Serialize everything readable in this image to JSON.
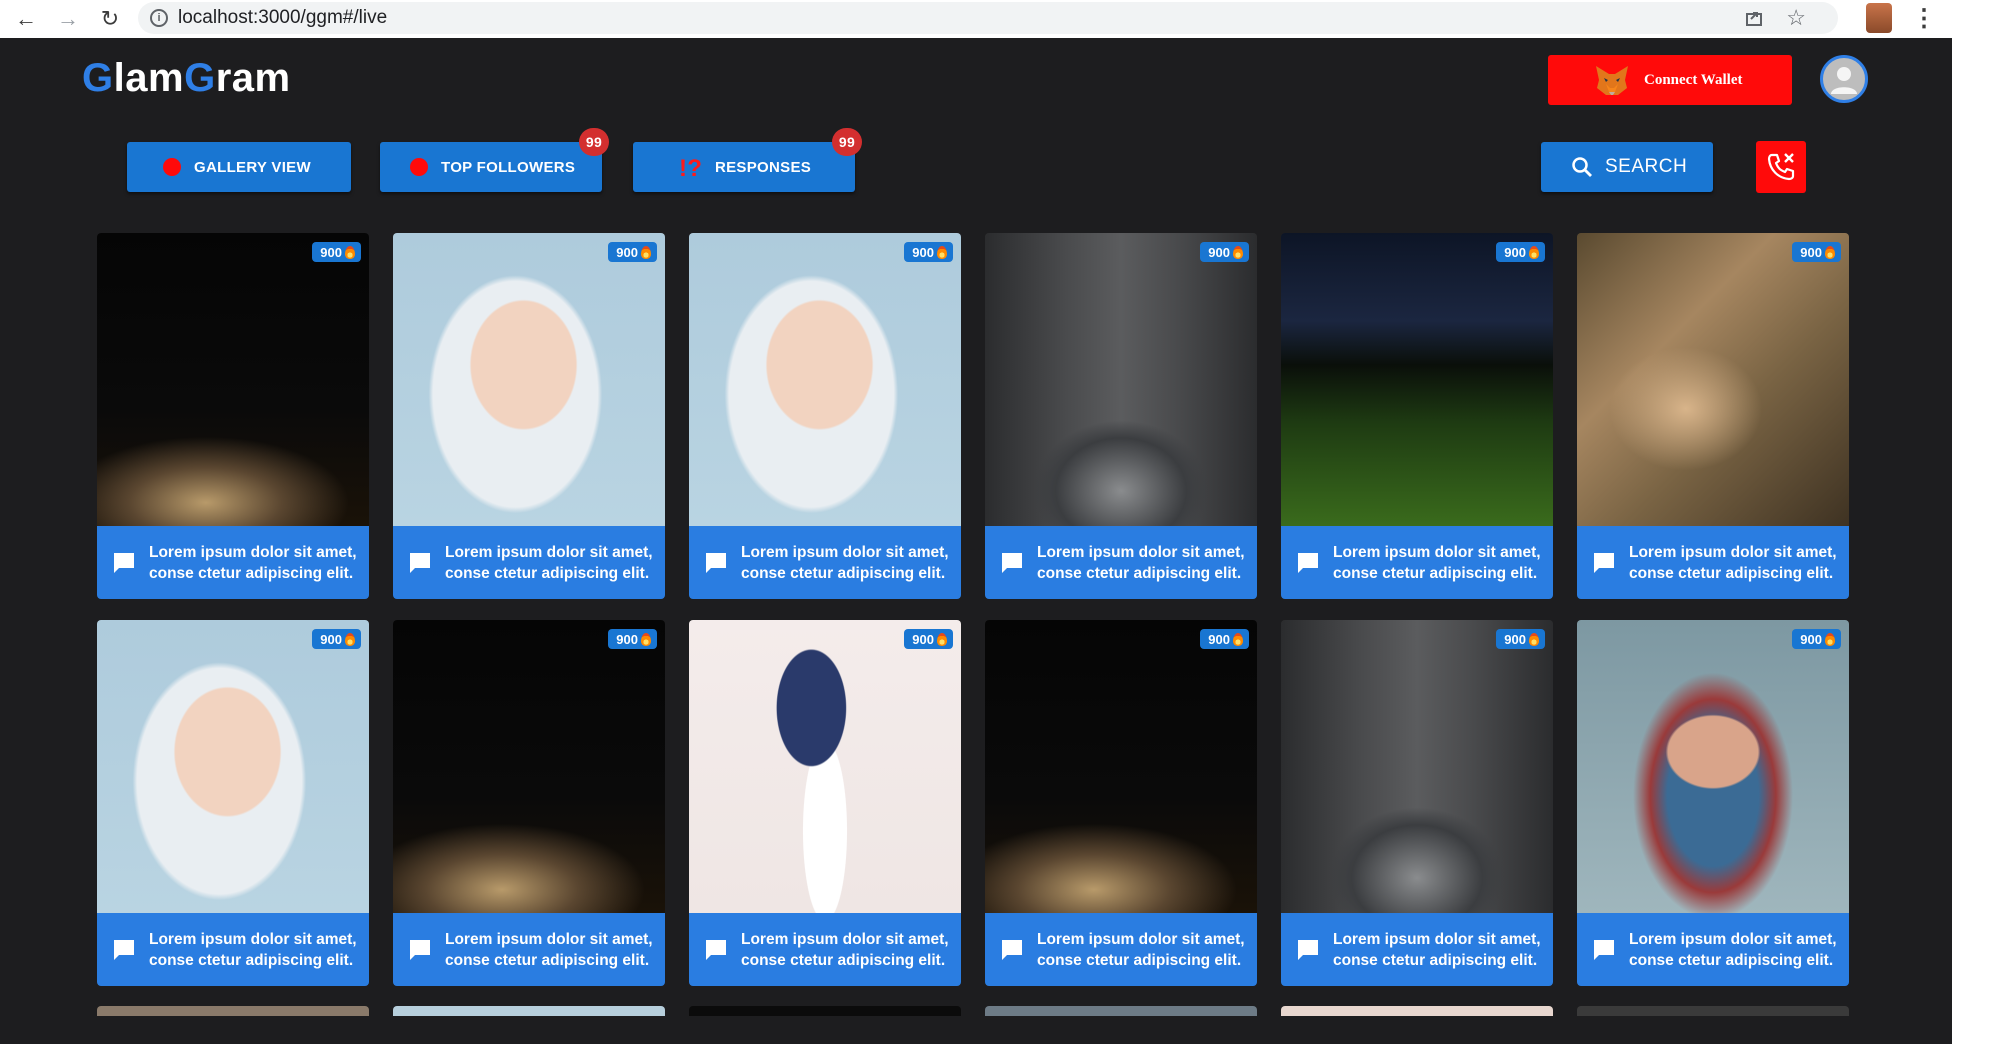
{
  "browser": {
    "url": "localhost:3000/ggm#/live"
  },
  "app": {
    "logo": {
      "g1": "G",
      "part1": "lam",
      "g2": "G",
      "part2": "ram"
    },
    "wallet_button": "Connect Wallet",
    "tabs": [
      {
        "label": "GALLERY VIEW",
        "badge": ""
      },
      {
        "label": "TOP FOLLOWERS",
        "badge": "99"
      },
      {
        "label": "RESPONSES",
        "badge": "99"
      }
    ],
    "search_button": "SEARCH",
    "colors": {
      "brand_blue": "#2f7fe6",
      "accent_red": "#ff0a0a",
      "caption_blue": "#2a7de1",
      "background": "#1d1d1f"
    }
  },
  "cards": [
    {
      "image": "bike-silhouette",
      "count": "900",
      "line1": "Lorem ipsum dolor sit amet,",
      "line2": "conse ctetur adipiscing elit."
    },
    {
      "image": "blonde-woman",
      "count": "900",
      "line1": "Lorem ipsum dolor sit amet,",
      "line2": "conse ctetur adipiscing elit."
    },
    {
      "image": "blonde-woman",
      "count": "900",
      "line1": "Lorem ipsum dolor sit amet,",
      "line2": "conse ctetur adipiscing elit."
    },
    {
      "image": "corridor-figure",
      "count": "900",
      "line1": "Lorem ipsum dolor sit amet,",
      "line2": "conse ctetur adipiscing elit."
    },
    {
      "image": "night-golf",
      "count": "900",
      "line1": "Lorem ipsum dolor sit amet,",
      "line2": "conse ctetur adipiscing elit."
    },
    {
      "image": "rock-lizard",
      "count": "900",
      "line1": "Lorem ipsum dolor sit amet,",
      "line2": "conse ctetur adipiscing elit."
    },
    {
      "image": "blonde-woman",
      "count": "900",
      "line1": "Lorem ipsum dolor sit amet,",
      "line2": "conse ctetur adipiscing elit."
    },
    {
      "image": "bike-silhouette",
      "count": "900",
      "line1": "Lorem ipsum dolor sit amet,",
      "line2": "conse ctetur adipiscing elit."
    },
    {
      "image": "jumping-girl",
      "count": "900",
      "line1": "Lorem ipsum dolor sit amet,",
      "line2": "conse ctetur adipiscing elit."
    },
    {
      "image": "bike-silhouette",
      "count": "900",
      "line1": "Lorem ipsum dolor sit amet,",
      "line2": "conse ctetur adipiscing elit."
    },
    {
      "image": "corridor-figure",
      "count": "900",
      "line1": "Lorem ipsum dolor sit amet,",
      "line2": "conse ctetur adipiscing elit."
    },
    {
      "image": "scarf-woman",
      "count": "900",
      "line1": "Lorem ipsum dolor sit amet,",
      "line2": "conse ctetur adipiscing elit."
    }
  ]
}
